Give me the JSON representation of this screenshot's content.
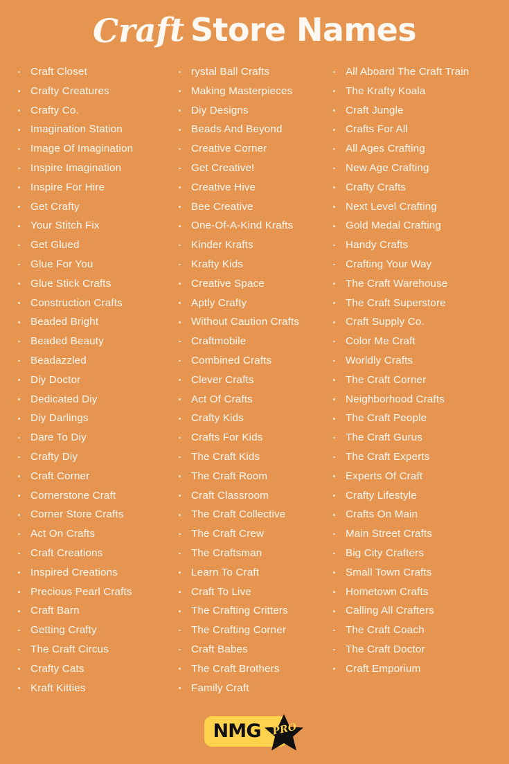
{
  "theme": {
    "background": "#E59550",
    "text": "#FDF8F2",
    "bullet": "#FAE8D6",
    "logo_plate": "#FFD24D",
    "logo_ink": "#111111"
  },
  "header": {
    "title_script": "Craft",
    "title_bold": "Store Names",
    "full_title": "Craft Store Names"
  },
  "columns": [
    {
      "id": "column-1",
      "items": [
        "Craft Closet",
        "Crafty Creatures",
        "Crafty Co.",
        "Imagination Station",
        "Image Of Imagination",
        "Inspire Imagination",
        "Inspire For Hire",
        "Get Crafty",
        "Your Stitch Fix",
        "Get Glued",
        "Glue For You",
        "Glue Stick Crafts",
        "Construction Crafts",
        "Beaded Bright",
        "Beaded Beauty",
        "Beadazzled",
        "Diy Doctor",
        "Dedicated Diy",
        "Diy Darlings",
        "Dare To Diy",
        "Crafty Diy",
        "Craft Corner",
        "Cornerstone Craft",
        "Corner Store Crafts",
        "Act On Crafts",
        "Craft Creations",
        "Inspired Creations",
        "Precious Pearl Crafts",
        "Craft Barn",
        "Getting Crafty",
        "The Craft Circus",
        "Crafty Cats",
        "Kraft Kitties"
      ]
    },
    {
      "id": "column-2",
      "items": [
        "rystal Ball Crafts",
        "Making Masterpieces",
        "Diy Designs",
        "Beads And Beyond",
        "Creative Corner",
        "Get Creative!",
        "Creative Hive",
        "Bee Creative",
        "One-Of-A-Kind Krafts",
        "Kinder Krafts",
        "Krafty Kids",
        "Creative Space",
        "Aptly Crafty",
        "Without Caution Crafts",
        "Craftmobile",
        "Combined Crafts",
        "Clever Crafts",
        "Act Of Crafts",
        "Crafty Kids",
        "Crafts For Kids",
        "The Craft Kids",
        "The Craft Room",
        "Craft Classroom",
        "The Craft Collective",
        "The Craft Crew",
        "The Craftsman",
        "Learn To Craft",
        "Craft To Live",
        "The Crafting Critters",
        "The Crafting Corner",
        "Craft Babes",
        "The Craft Brothers",
        "Family Craft"
      ]
    },
    {
      "id": "column-3",
      "items": [
        "All Aboard The Craft Train",
        "The Krafty Koala",
        "Craft Jungle",
        "Crafts For All",
        "All Ages Crafting",
        "New Age Crafting",
        "Crafty Crafts",
        "Next Level Crafting",
        "Gold Medal Crafting",
        "Handy Crafts",
        "Crafting Your Way",
        "The Craft Warehouse",
        "The Craft Superstore",
        "Craft Supply Co.",
        "Color Me Craft",
        "Worldly Crafts",
        "The Craft Corner",
        "Neighborhood Crafts",
        "The Craft People",
        "The Craft Gurus",
        "The Craft Experts",
        "Experts Of Craft",
        "Crafty Lifestyle",
        "Crafts On Main",
        "Main Street Crafts",
        "Big City Crafters",
        "Small Town Crafts",
        "Hometown Crafts",
        "Calling All Crafters",
        "The Craft Coach",
        "The Craft Doctor",
        "Craft Emporium"
      ]
    }
  ],
  "footer": {
    "logo_text": "NMG",
    "logo_badge": "PRO",
    "star_icon": "star-icon"
  }
}
